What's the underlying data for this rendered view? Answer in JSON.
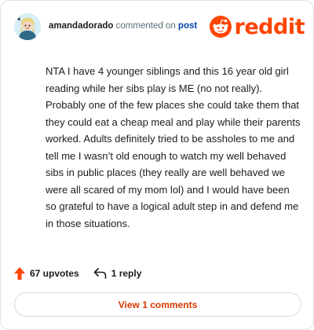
{
  "comment": {
    "username": "amandadorado",
    "action_text": "commented on",
    "post_link": "post",
    "body": "NTA I have 4 younger siblings and this 16 year old girl reading while her sibs play is ME (no not really). Probably one of the few places she could take them that they could eat a cheap meal and play while their parents worked. Adults definitely tried to be assholes to me and tell me I wasn’t old enough to watch my well behaved sibs in public places (they really are well behaved we were all scared of my mom lol) and I would have been so grateful to have a logical adult step in and defend me in those situations."
  },
  "brand": {
    "name": "reddit",
    "color": "#ff4500",
    "icon": "reddit-snoo-icon"
  },
  "stats": {
    "upvotes": "67 upvotes",
    "replies": "1 reply",
    "upvote_icon": "upvote-arrow-icon",
    "reply_icon": "reply-arrow-icon"
  },
  "view_button": "View 1 comments",
  "colors": {
    "link": "#0045ac",
    "meta": "#576f76",
    "view_button_text": "#d93900",
    "upvote_arrow": "#ff4500"
  }
}
